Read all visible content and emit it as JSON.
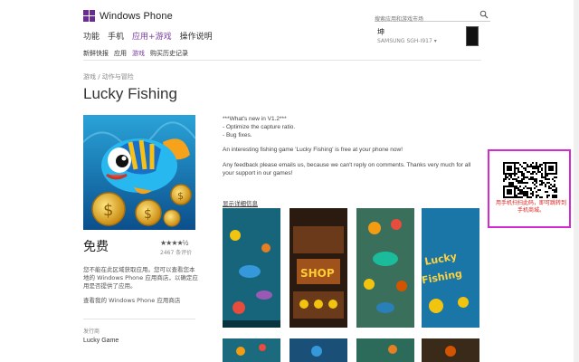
{
  "header": {
    "brand": "Windows Phone",
    "search_placeholder": "搜索应用和游戏市场",
    "user": "坤",
    "device": "SAMSUNG SGH-I917"
  },
  "nav": {
    "items": [
      {
        "label": "功能",
        "active": false
      },
      {
        "label": "手机",
        "active": false
      },
      {
        "label": "应用+游戏",
        "active": true
      },
      {
        "label": "操作说明",
        "active": false
      }
    ]
  },
  "subnav": {
    "items": [
      {
        "label": "新鲜快报",
        "active": false
      },
      {
        "label": "应用",
        "active": false
      },
      {
        "label": "游戏",
        "active": true
      },
      {
        "label": "购买历史记录",
        "active": false
      }
    ]
  },
  "app": {
    "breadcrumb": "游戏 / 动作与冒险",
    "title": "Lucky Fishing",
    "price": "免费",
    "stars": "★★★★½",
    "rating_count": "2467 条评价",
    "notice": "您不能在此区域获取应用。您可以查看您本地的 Windows Phone 应用商店，以确定应用是否提供了应用。",
    "notice_link": "查看我的 Windows Phone 应用商店",
    "publisher_label": "发行商",
    "publisher": "Lucky Game",
    "description": {
      "p1": [
        "***What's new in V1.2***",
        "- Optimize the capture ratio.",
        "- Bug fixes."
      ],
      "p2": "An interesting fishing game 'Lucky Fishing' is free at your phone now!",
      "p3": "Any feedback please emails us, because we can't reply on comments. Thanks very much for all your support in our games!"
    },
    "details_link": "显示详细信息",
    "screenshots": [
      "screenshot-1",
      "screenshot-2",
      "screenshot-3",
      "screenshot-4"
    ]
  },
  "qr": {
    "text": "用手机扫扫此码，即可跳转到手机商城。"
  },
  "colors": {
    "accent": "#7b3fa0",
    "qr_border": "#d42bd0",
    "qr_text": "#e0221f"
  }
}
